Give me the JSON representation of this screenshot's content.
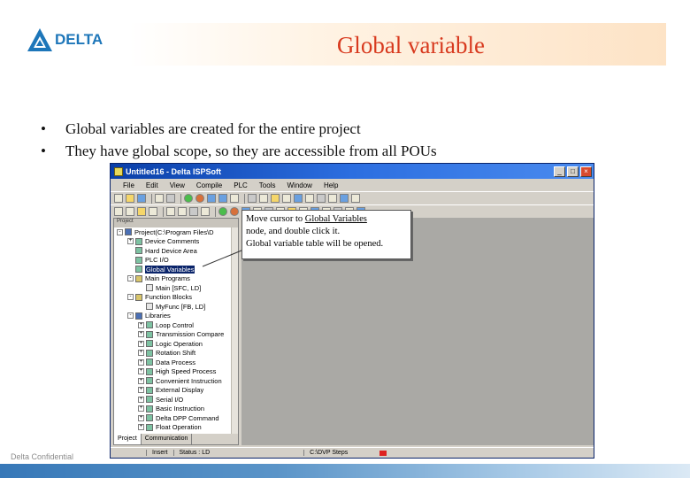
{
  "logo": {
    "text": "DELTA",
    "color": "#1d76b9"
  },
  "slide": {
    "title": "Global variable",
    "bullets": [
      "Global variables are created for the entire project",
      "They have global scope, so they are accessible from all POUs"
    ],
    "footer": "Delta Confidential"
  },
  "window": {
    "title": "Untitled16 - Delta ISPSoft",
    "menu": [
      "File",
      "Edit",
      "View",
      "Compile",
      "PLC",
      "Tools",
      "Window",
      "Help"
    ],
    "tree": [
      {
        "label": "Project(C:\\Program Files\\D",
        "icon": "project-icon",
        "level": 0,
        "toggle": "-"
      },
      {
        "label": "Device Comments",
        "icon": "device-comment-icon",
        "level": 1,
        "toggle": "+"
      },
      {
        "label": "Hard Device Area",
        "icon": "hardware-icon",
        "level": 1,
        "toggle": ""
      },
      {
        "label": "PLC I/O",
        "icon": "io-icon",
        "level": 1,
        "toggle": ""
      },
      {
        "label": "Global Variables",
        "icon": "global-variables-icon",
        "level": 1,
        "toggle": "",
        "selected": true
      },
      {
        "label": "Main Programs",
        "icon": "main-programs-icon",
        "level": 1,
        "toggle": "-"
      },
      {
        "label": "Main [SFC, LD]",
        "icon": "program-icon",
        "level": 2,
        "toggle": ""
      },
      {
        "label": "Function Blocks",
        "icon": "function-blocks-icon",
        "level": 1,
        "toggle": "-"
      },
      {
        "label": "MyFunc [FB, LD]",
        "icon": "function-block-icon",
        "level": 2,
        "toggle": ""
      },
      {
        "label": "Libraries",
        "icon": "libraries-icon",
        "level": 1,
        "toggle": "-"
      },
      {
        "label": "Loop Control",
        "icon": "library-icon",
        "level": 2,
        "toggle": "+"
      },
      {
        "label": "Transmission Compare",
        "icon": "library-icon",
        "level": 2,
        "toggle": "+"
      },
      {
        "label": "Logic Operation",
        "icon": "library-icon",
        "level": 2,
        "toggle": "+"
      },
      {
        "label": "Rotation Shift",
        "icon": "library-icon",
        "level": 2,
        "toggle": "+"
      },
      {
        "label": "Data Process",
        "icon": "library-icon",
        "level": 2,
        "toggle": "+"
      },
      {
        "label": "High Speed Process",
        "icon": "library-icon",
        "level": 2,
        "toggle": "+"
      },
      {
        "label": "Convenient Instruction",
        "icon": "library-icon",
        "level": 2,
        "toggle": "+"
      },
      {
        "label": "External Display",
        "icon": "library-icon",
        "level": 2,
        "toggle": "+"
      },
      {
        "label": "Serial I/O",
        "icon": "library-icon",
        "level": 2,
        "toggle": "+"
      },
      {
        "label": "Basic Instruction",
        "icon": "library-icon",
        "level": 2,
        "toggle": "+"
      },
      {
        "label": "Delta DPP Command",
        "icon": "library-icon",
        "level": 2,
        "toggle": "+"
      },
      {
        "label": "Float Operation",
        "icon": "library-icon",
        "level": 2,
        "toggle": "+"
      }
    ],
    "tabs": [
      "Project",
      "Communication"
    ],
    "status": [
      "Insert",
      "Status : LD",
      "C:\\DVP Steps"
    ]
  },
  "callout": {
    "line1_pre": "Move cursor to ",
    "line1_link": "Global Variables",
    "line2": "node, and double click it.",
    "line3": "Global variable table will be opened."
  }
}
